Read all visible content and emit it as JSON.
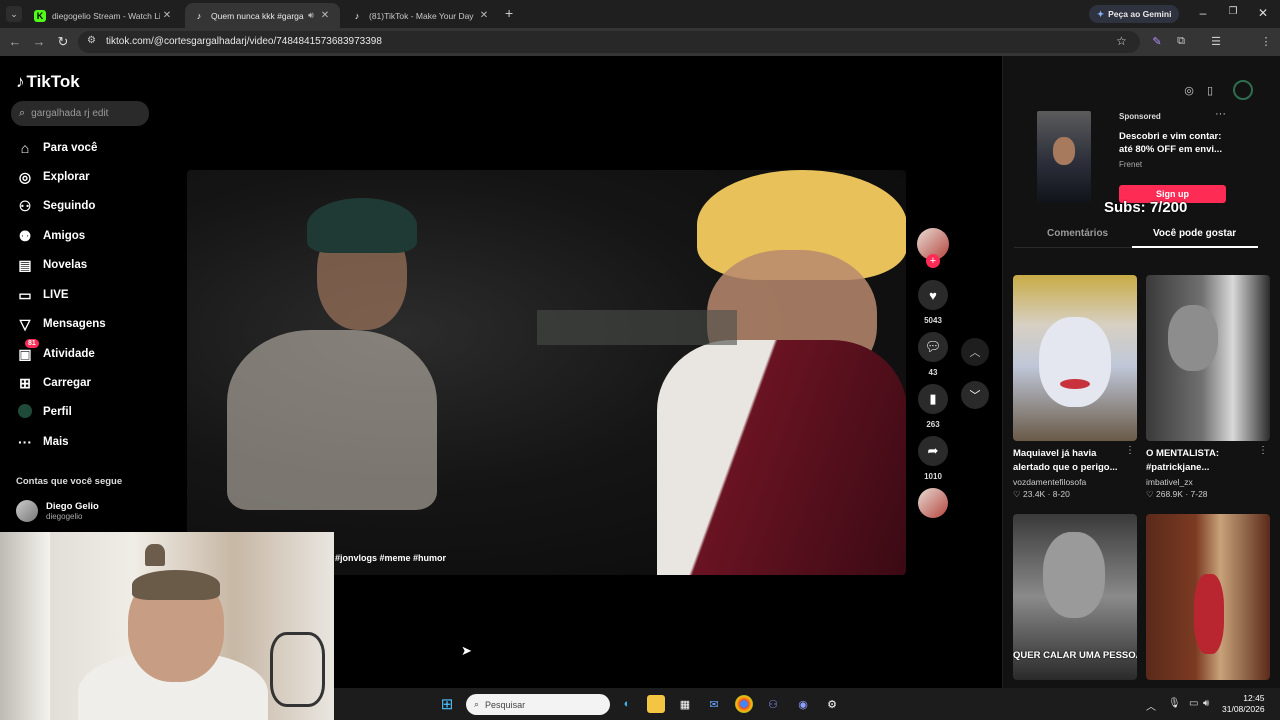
{
  "browser": {
    "tabs": [
      {
        "title": "diegogelio Stream - Watch Live",
        "favicon": "kick-icon",
        "active": false
      },
      {
        "title": "Quem nunca kkk #gargalhe",
        "favicon": "tiktok-icon",
        "active": true
      },
      {
        "title": "(81)TikTok - Make Your Day",
        "favicon": "tiktok-icon",
        "active": false
      }
    ],
    "gemini_label": "Peça ao Gemini",
    "url": "tiktok.com/@cortesgargalhadarj/video/7484841573683973398"
  },
  "tiktok": {
    "logo_text": "TikTok",
    "search_placeholder": "gargalhada rj edit",
    "nav": [
      {
        "label": "Para você",
        "icon": "home-icon"
      },
      {
        "label": "Explorar",
        "icon": "compass-icon"
      },
      {
        "label": "Seguindo",
        "icon": "following-icon"
      },
      {
        "label": "Amigos",
        "icon": "friends-icon"
      },
      {
        "label": "Novelas",
        "icon": "novelas-icon"
      },
      {
        "label": "LIVE",
        "icon": "live-icon"
      },
      {
        "label": "Mensagens",
        "icon": "messages-icon"
      },
      {
        "label": "Atividade",
        "icon": "activity-icon",
        "badge": "81"
      },
      {
        "label": "Carregar",
        "icon": "upload-icon"
      },
      {
        "label": "Perfil",
        "icon": "profile-icon"
      },
      {
        "label": "Mais",
        "icon": "more-icon"
      }
    ],
    "followed_title": "Contas que você segue",
    "followed_account": {
      "name": "Diego Gelio",
      "handle": "diegogelio"
    },
    "video_hashtags": "#jonvlogs #meme #humor",
    "actions": {
      "likes": "5043",
      "comments": "43",
      "saves": "263",
      "shares": "1010"
    }
  },
  "right_panel": {
    "ad": {
      "sponsored_label": "Sponsored",
      "text": "Descobri e vim contar: até 80% OFF em envi...",
      "brand": "Frenet",
      "cta": "Sign up"
    },
    "overlay_subs": "Subs: 7/200",
    "tabs": [
      "Comentários",
      "Você pode gostar"
    ],
    "active_tab": "Você pode gostar",
    "cards": [
      {
        "title": "Maquiavel já havia alertado que o perigo...",
        "author": "vozdamentefilosofa",
        "likes": "23.4K",
        "date": "8-20"
      },
      {
        "title": "O MENTALISTA: #patrickjane...",
        "author": "imbativel_zx",
        "likes": "268.9K",
        "date": "7-28"
      },
      {
        "overlay": "QUER CALAR UMA PESSOA"
      },
      {
        "overlay": ""
      }
    ]
  },
  "taskbar": {
    "search_placeholder": "Pesquisar",
    "time": "12:45",
    "date": "31/08/2026"
  }
}
